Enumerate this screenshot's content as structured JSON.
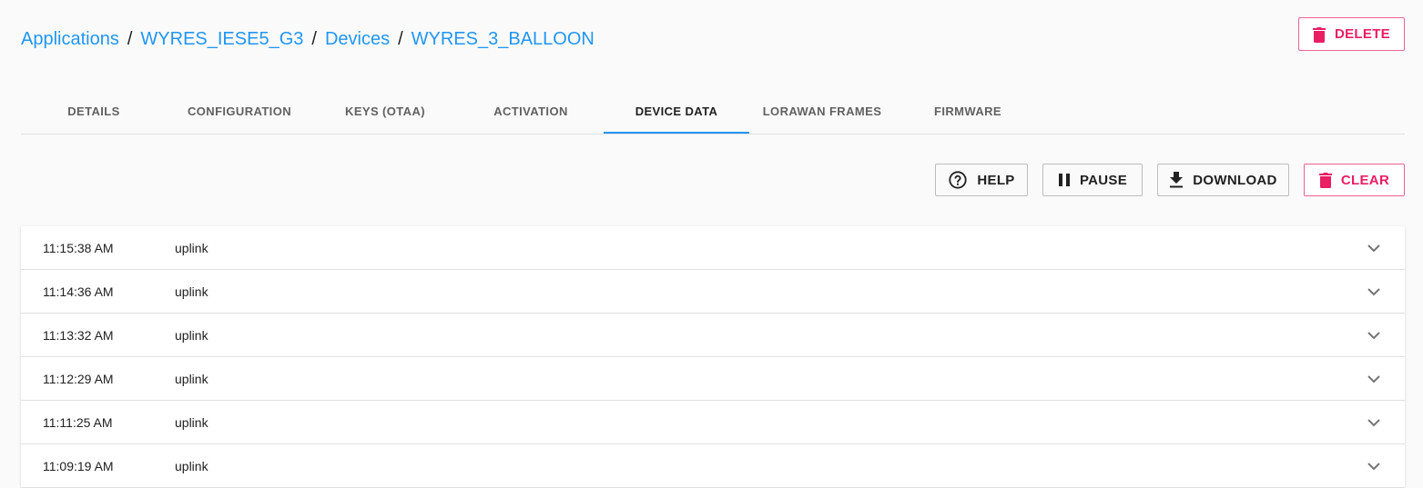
{
  "breadcrumb": {
    "items": [
      "Applications",
      "WYRES_IESE5_G3",
      "Devices",
      "WYRES_3_BALLOON"
    ],
    "separator": "/"
  },
  "header": {
    "delete_label": "DELETE"
  },
  "tabs": [
    {
      "label": "DETAILS"
    },
    {
      "label": "CONFIGURATION"
    },
    {
      "label": "KEYS (OTAA)"
    },
    {
      "label": "ACTIVATION"
    },
    {
      "label": "DEVICE DATA",
      "active": true
    },
    {
      "label": "LORAWAN FRAMES"
    },
    {
      "label": "FIRMWARE"
    }
  ],
  "toolbar": {
    "help_label": "HELP",
    "pause_label": "PAUSE",
    "download_label": "DOWNLOAD",
    "clear_label": "CLEAR"
  },
  "events": [
    {
      "time": "11:15:38 AM",
      "type": "uplink"
    },
    {
      "time": "11:14:36 AM",
      "type": "uplink"
    },
    {
      "time": "11:13:32 AM",
      "type": "uplink"
    },
    {
      "time": "11:12:29 AM",
      "type": "uplink"
    },
    {
      "time": "11:11:25 AM",
      "type": "uplink"
    },
    {
      "time": "11:09:19 AM",
      "type": "uplink"
    }
  ],
  "colors": {
    "accent": "#2196f3",
    "danger": "#e91e63",
    "background": "#fafafa"
  },
  "icons": {
    "delete": "trash-icon",
    "help": "help-circle-icon",
    "pause": "pause-icon",
    "download": "download-icon",
    "clear": "trash-icon",
    "expand": "chevron-down-icon"
  }
}
